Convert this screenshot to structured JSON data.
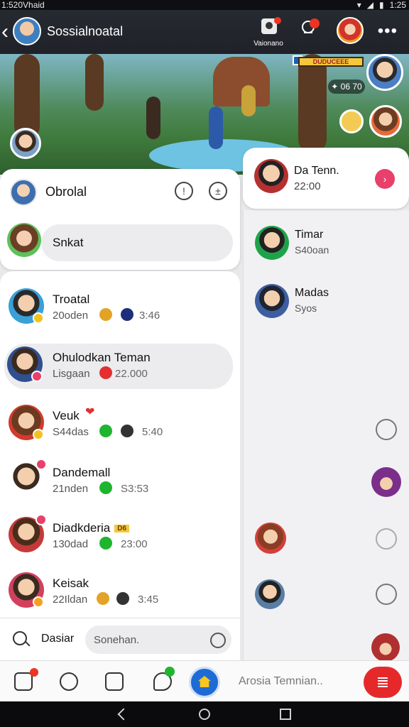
{
  "status_bar": {
    "left": "1:520Vhaid",
    "right_icons": [
      "wifi-icon",
      "signal-icon",
      "battery-icon"
    ],
    "time": "1:25"
  },
  "header": {
    "title": "Sossialnoatal",
    "voice_label": "Vaionano",
    "icons": [
      "back-icon",
      "voice-room-icon",
      "notification-icon",
      "profile-avatar",
      "more-icon"
    ]
  },
  "banner": {
    "hud_text": "DUDUCEEE",
    "score": "✦ 06 70"
  },
  "chat_header": {
    "title": "Obrolal",
    "buttons": [
      "info-icon",
      "filter-icon"
    ]
  },
  "search_top": {
    "text": "Snkat"
  },
  "chats": [
    {
      "name": "Troatal",
      "sub": "20oden",
      "time": "3:46",
      "highlight": false,
      "tag": ""
    },
    {
      "name": "Ohulodkan Teman",
      "sub": "Lisgaan",
      "time": "22.000",
      "highlight": true,
      "tag": ""
    },
    {
      "name": "Veuk",
      "sub": "S44das",
      "time": "5:40",
      "highlight": false,
      "tag": ""
    },
    {
      "name": "Dandemall",
      "sub": "21nden",
      "time": "S3:53",
      "highlight": false,
      "tag": ""
    },
    {
      "name": "Diadkderia",
      "sub": "130dad",
      "time": "23:00",
      "highlight": false,
      "tag": "D6"
    },
    {
      "name": "Keisak",
      "sub": "22Ildan",
      "time": "3:45",
      "highlight": false,
      "tag": ""
    }
  ],
  "search_bottom": {
    "label": "Dasiar",
    "placeholder": "Sonehan."
  },
  "right_top": {
    "name": "Da Tenn.",
    "time": "22:00"
  },
  "right_list": [
    {
      "name": "Timar",
      "sub": "S40oan"
    },
    {
      "name": "Madas",
      "sub": "Syos"
    }
  ],
  "bottom_nav": {
    "items": [
      "home-icon",
      "search-icon",
      "gallery-icon",
      "chat-icon",
      "home-center-icon"
    ],
    "add_friend": "Arosia Temnian..",
    "fab_icon": "list-icon"
  },
  "colors": {
    "accent": "#e5292b",
    "highlight_row": "#ececee",
    "pink": "#e8406a",
    "green": "#1fb52e"
  }
}
